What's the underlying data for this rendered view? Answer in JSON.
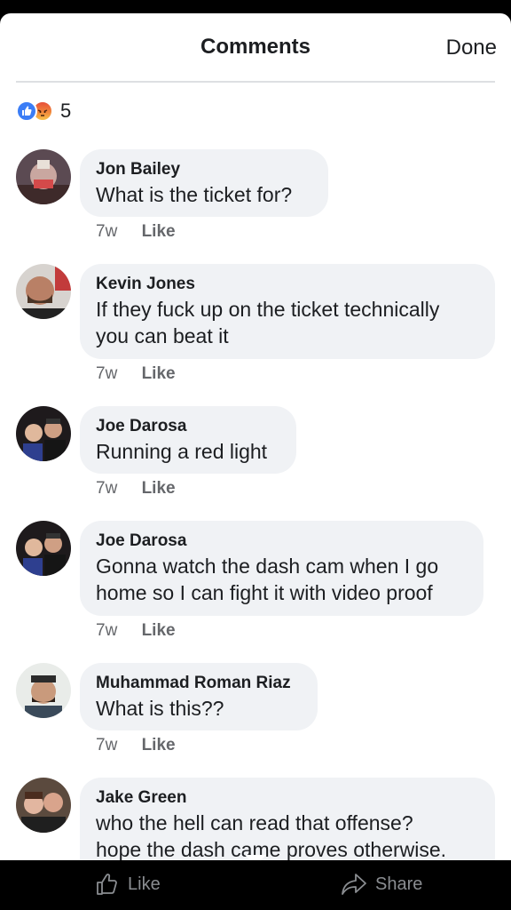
{
  "header": {
    "title": "Comments",
    "done_label": "Done"
  },
  "reactions": {
    "types": [
      "like-icon",
      "angry-icon"
    ],
    "count": "5"
  },
  "comments": [
    {
      "author": "Jon Bailey",
      "lines": [
        "What is the ticket for?"
      ],
      "time": "7w",
      "like": "Like"
    },
    {
      "author": "Kevin Jones",
      "lines": [
        "If they fuck up on the ticket technically",
        "you can beat it"
      ],
      "time": "7w",
      "like": "Like"
    },
    {
      "author": "Joe Darosa",
      "lines": [
        "Running a red light"
      ],
      "time": "7w",
      "like": "Like"
    },
    {
      "author": "Joe Darosa",
      "lines": [
        "Gonna watch the dash cam when I go",
        "home so I can fight it with video proof"
      ],
      "time": "7w",
      "like": "Like"
    },
    {
      "author": "Muhammad Roman Riaz",
      "lines": [
        "What is this??"
      ],
      "time": "7w",
      "like": "Like"
    },
    {
      "author": "Jake Green",
      "lines": [
        "who the hell can read that offense?",
        "hope the dash came proves otherwise."
      ],
      "time": "",
      "like": ""
    }
  ],
  "bottom_bar": {
    "like_label": "Like",
    "share_label": "Share"
  },
  "colors": {
    "bubble": "#f0f2f5",
    "text": "#1c1e21",
    "meta": "#65676b",
    "like_blue": "#3b7df6"
  }
}
